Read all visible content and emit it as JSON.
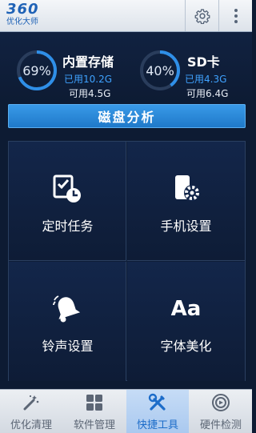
{
  "header": {
    "logo_number": "360",
    "logo_subtitle": "优化大师",
    "settings_icon": "gear-icon",
    "more_icon": "more-vertical-icon"
  },
  "storage": {
    "internal": {
      "title": "内置存储",
      "percent_label": "69%",
      "percent_value": 69,
      "used": "已用10.2G",
      "free": "可用4.5G"
    },
    "sd": {
      "title": "SD卡",
      "percent_label": "40%",
      "percent_value": 40,
      "used": "已用4.3G",
      "free": "可用6.4G"
    },
    "analyze_button": "磁盘分析"
  },
  "tools": [
    {
      "label": "定时任务",
      "icon": "scheduled-task-icon"
    },
    {
      "label": "手机设置",
      "icon": "phone-settings-icon"
    },
    {
      "label": "铃声设置",
      "icon": "bell-icon"
    },
    {
      "label": "字体美化",
      "icon": "font-icon",
      "icon_text": "Aa"
    }
  ],
  "bottom_nav": [
    {
      "label": "优化清理",
      "icon": "magic-wand-icon",
      "active": false
    },
    {
      "label": "软件管理",
      "icon": "apps-grid-icon",
      "active": false
    },
    {
      "label": "快捷工具",
      "icon": "tools-icon",
      "active": true
    },
    {
      "label": "硬件检测",
      "icon": "hardware-check-icon",
      "active": false
    }
  ],
  "colors": {
    "background": "#0d1b33",
    "accent_blue": "#3fa2ff",
    "button_blue": "#2a88d8",
    "active_tab": "#1c6cc9"
  }
}
